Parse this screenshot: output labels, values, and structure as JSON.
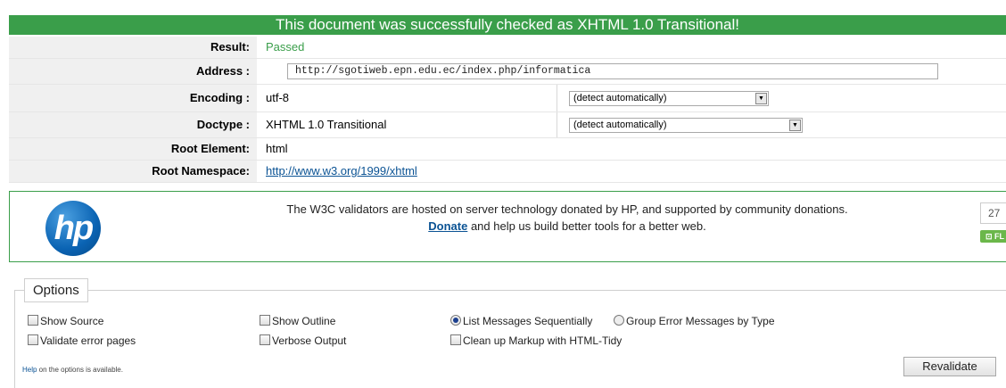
{
  "banner": "This document was successfully checked as XHTML 1.0 Transitional!",
  "result": {
    "label": "Result:",
    "value": "Passed"
  },
  "address": {
    "label": "Address :",
    "value": "http://sgotiweb.epn.edu.ec/index.php/informatica"
  },
  "encoding": {
    "label": "Encoding :",
    "value": "utf-8",
    "select": "(detect automatically)"
  },
  "doctype": {
    "label": "Doctype :",
    "value": "XHTML 1.0 Transitional",
    "select": "(detect automatically)"
  },
  "root_element": {
    "label": "Root Element:",
    "value": "html"
  },
  "root_namespace": {
    "label": "Root Namespace:",
    "value": "http://www.w3.org/1999/xhtml"
  },
  "sponsor": {
    "logo": "hp",
    "line1": "The W3C validators are hosted on server technology donated by HP, and supported by community donations.",
    "donate": "Donate",
    "line2_rest": " and help us build better tools for a better web.",
    "count": "27",
    "flattr": "FL"
  },
  "options": {
    "legend": "Options",
    "show_source": "Show Source",
    "show_outline": "Show Outline",
    "list_sequential": "List Messages Sequentially",
    "group_by_type": "Group Error Messages by Type",
    "validate_error_pages": "Validate error pages",
    "verbose_output": "Verbose Output",
    "cleanup": "Clean up Markup with HTML-Tidy",
    "help_link": "Help",
    "help_rest": " on the options is available.",
    "revalidate": "Revalidate"
  },
  "colors": {
    "success": "#3a9e4a",
    "link": "#0b5394"
  }
}
